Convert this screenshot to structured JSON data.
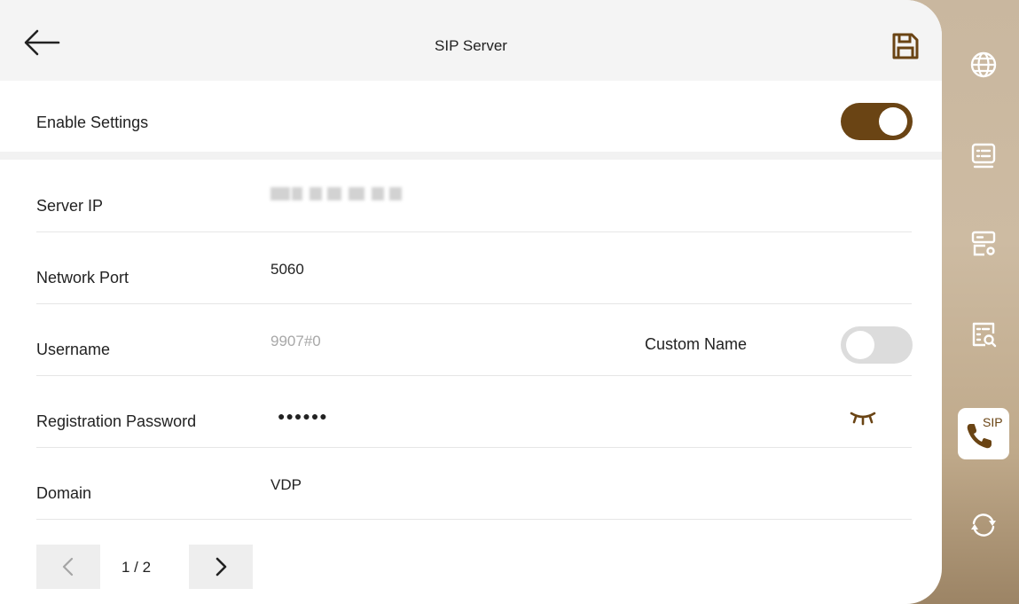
{
  "header": {
    "title": "SIP Server"
  },
  "enable": {
    "label": "Enable Settings",
    "on": true
  },
  "fields": {
    "server_ip": {
      "label": "Server IP"
    },
    "network_port": {
      "label": "Network Port",
      "value": "5060"
    },
    "username": {
      "label": "Username",
      "placeholder": "9907#0",
      "custom_label": "Custom Name",
      "custom_on": false
    },
    "password": {
      "label": "Registration Password",
      "value": "●●●●●●"
    },
    "domain": {
      "label": "Domain",
      "value": "VDP"
    }
  },
  "pager": {
    "text": "1 / 2"
  },
  "sidebar": {
    "sip_badge": "SIP",
    "items": [
      "globe-icon",
      "list-settings-icon",
      "server-settings-icon",
      "search-list-icon",
      "sip-phone-icon",
      "sync-icon"
    ]
  },
  "colors": {
    "accent": "#6a4414",
    "panel": "#ffffff",
    "header": "#f4f4f4"
  }
}
